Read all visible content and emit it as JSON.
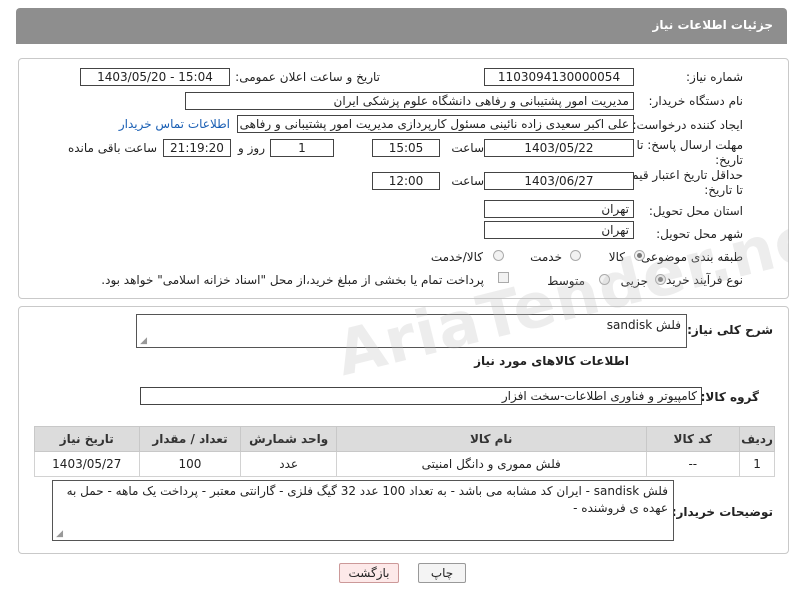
{
  "header": {
    "title": "جزئیات اطلاعات نیاز"
  },
  "fields": {
    "need_number_label": "شماره نیاز:",
    "need_number": "1103094130000054",
    "announce_label": "تاریخ و ساعت اعلان عمومی:",
    "announce_value": "1403/05/20 - 15:04",
    "buyer_org_label": "نام دستگاه خریدار:",
    "buyer_org": "مدیریت امور پشتیبانی و رفاهی دانشگاه علوم پزشکی ایران",
    "requester_label": "ایجاد کننده درخواست:",
    "requester": "علی اکبر سعیدی زاده نائینی مسئول کارپردازی مدیریت امور پشتیبانی و رفاهی",
    "contact_link": "اطلاعات تماس خریدار",
    "deadline_label": "مهلت ارسال پاسخ: تا تاریخ:",
    "deadline_date": "1403/05/22",
    "time_label": "ساعت",
    "deadline_time": "15:05",
    "days_value": "1",
    "days_label": "روز و",
    "remaining_time": "21:19:20",
    "remaining_label": "ساعت باقی مانده",
    "price_validity_label": "حداقل تاریخ اعتبار قیمت: تا تاریخ:",
    "price_validity_date": "1403/06/27",
    "price_validity_time": "12:00",
    "province_label": "استان محل تحویل:",
    "province": "تهران",
    "city_label": "شهر محل تحویل:",
    "city": "تهران",
    "category_label": "طبقه بندی موضوعی:",
    "category_options": [
      "کالا",
      "خدمت",
      "کالا/خدمت"
    ],
    "process_label": "نوع فرآیند خرید :",
    "process_options": [
      "جزیی",
      "متوسط"
    ],
    "payment_note": "پرداخت تمام یا بخشی از مبلغ خرید،از محل \"اسناد خزانه اسلامی\" خواهد بود."
  },
  "summary": {
    "label": "شرح کلی نیاز:",
    "value": "فلش sandisk",
    "goods_info_title": "اطلاعات کالاهای مورد نیاز",
    "group_label": "گروه کالا:",
    "group_value": "کامپیوتر و فناوری اطلاعات-سخت افزار"
  },
  "table": {
    "headers": [
      "ردیف",
      "کد کالا",
      "نام کالا",
      "واحد شمارش",
      "تعداد / مقدار",
      "تاریخ نیاز"
    ],
    "rows": [
      [
        "1",
        "--",
        "فلش مموری و دانگل امنیتی",
        "عدد",
        "100",
        "1403/05/27"
      ]
    ]
  },
  "buyer_notes": {
    "label": "توضیحات خریدار:",
    "value": "فلش sandisk - ایران کد مشابه می باشد -   به تعداد 100 عدد 32 گیگ فلزی - گارانتی معتبر - پرداخت یک ماهه - حمل به عهده ی فروشنده -"
  },
  "buttons": {
    "print": "چاپ",
    "back": "بازگشت"
  },
  "watermark": "AriaTender.net"
}
